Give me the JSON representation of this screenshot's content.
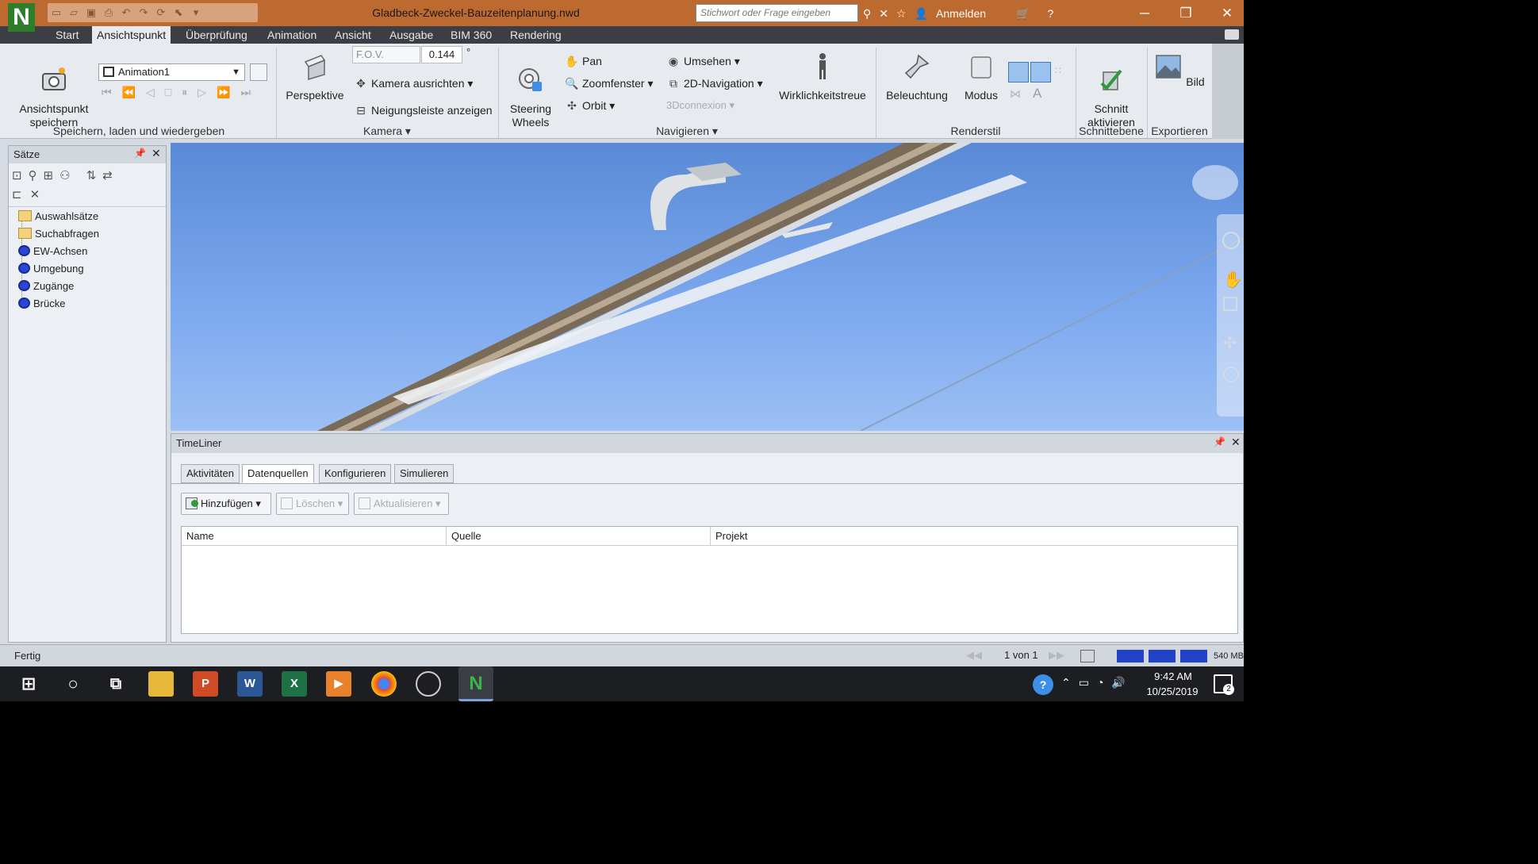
{
  "window": {
    "title": "Gladbeck-Zweckel-Bauzeitenplanung.nwd",
    "app_logo": "N",
    "search_placeholder": "Stichwort oder Frage eingeben",
    "signin": "Anmelden",
    "controls": [
      "minimize-icon",
      "restore-icon",
      "close-icon"
    ]
  },
  "menu": {
    "tabs": [
      "Start",
      "Ansichtspunkt",
      "Überprüfung",
      "Animation",
      "Ansicht",
      "Ausgabe",
      "BIM 360",
      "Rendering"
    ],
    "active": "Ansichtspunkt"
  },
  "ribbon": {
    "save_viewpoint": "Ansichtspunkt\nspeichern",
    "animation_select": "Animation1",
    "group_save": "Speichern, laden und wiedergeben",
    "perspective": "Perspektive",
    "fov_label": "F.O.V.",
    "fov_value": "0.144",
    "fov_unit": "°",
    "camera_align": "Kamera ausrichten",
    "tilt_bar": "Neigungsleiste anzeigen",
    "group_camera": "Kamera",
    "steering": "Steering\nWheels",
    "pan": "Pan",
    "zoom_window": "Zoomfenster",
    "orbit": "Orbit",
    "look_around": "Umsehen",
    "nav2d": "2D-Navigation",
    "connexion": "3Dconnexion",
    "realism": "Wirklichkeitstreue",
    "group_navigate": "Navigieren",
    "lighting": "Beleuchtung",
    "mode": "Modus",
    "group_render": "Renderstil",
    "section_enable": "Schnitt\naktivieren",
    "group_section": "Schnittebene",
    "image": "Bild",
    "group_export": "Exportieren"
  },
  "sets_panel": {
    "title": "Sätze",
    "items": [
      {
        "label": "Auswahlsätze",
        "type": "folder"
      },
      {
        "label": "Suchabfragen",
        "type": "folder"
      },
      {
        "label": "EW-Achsen",
        "type": "set"
      },
      {
        "label": "Umgebung",
        "type": "set"
      },
      {
        "label": "Zugänge",
        "type": "set"
      },
      {
        "label": "Brücke",
        "type": "set"
      }
    ]
  },
  "timeliner": {
    "title": "TimeLiner",
    "tabs": [
      "Aktivitäten",
      "Datenquellen",
      "Konfigurieren",
      "Simulieren"
    ],
    "active_tab": "Datenquellen",
    "buttons": [
      "Hinzufügen",
      "Löschen",
      "Aktualisieren"
    ],
    "columns": [
      "Name",
      "Quelle",
      "Projekt"
    ]
  },
  "status": {
    "text": "Fertig",
    "page": "1 von 1",
    "memory": "540 MB"
  },
  "taskbar": {
    "time": "9:42 AM",
    "date": "10/25/2019",
    "notification_count": "2",
    "apps": [
      "windows-start-icon",
      "search-icon",
      "task-view-icon",
      "file-explorer-icon",
      "powerpoint-icon",
      "word-icon",
      "excel-icon",
      "media-player-icon",
      "chrome-icon",
      "app-icon",
      "navisworks-icon"
    ]
  },
  "colors": {
    "titlebar": "#bd6a30",
    "ribbon": "#e7eaef",
    "sky_top": "#5a8ad6",
    "sky_bottom": "#9cc0f4"
  }
}
